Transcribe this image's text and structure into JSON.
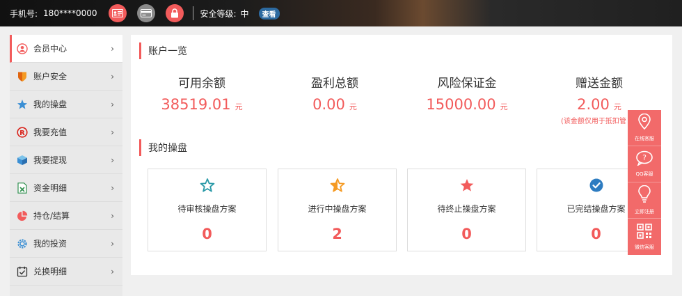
{
  "topbar": {
    "phone_label": "手机号:",
    "phone_value": "180****0000",
    "icons": [
      "id-card-icon",
      "bank-card-icon",
      "lock-icon"
    ],
    "security_label": "安全等级:",
    "security_value": "中",
    "check_button": "查看"
  },
  "sidebar": {
    "items": [
      {
        "label": "会员中心",
        "icon": "user-icon",
        "active": true
      },
      {
        "label": "账户安全",
        "icon": "shield-icon"
      },
      {
        "label": "我的操盘",
        "icon": "star-icon"
      },
      {
        "label": "我要充值",
        "icon": "recharge-icon"
      },
      {
        "label": "我要提现",
        "icon": "box-icon"
      },
      {
        "label": "资金明细",
        "icon": "spreadsheet-icon"
      },
      {
        "label": "持仓/结算",
        "icon": "pie-chart-icon"
      },
      {
        "label": "我的投资",
        "icon": "gear-icon"
      },
      {
        "label": "兑换明细",
        "icon": "calendar-check-icon"
      }
    ],
    "chevron": "›"
  },
  "account": {
    "title": "账户一览",
    "stats": [
      {
        "label": "可用余额",
        "value": "38519.01",
        "unit": "元"
      },
      {
        "label": "盈利总额",
        "value": "0.00",
        "unit": "元"
      },
      {
        "label": "风险保证金",
        "value": "15000.00",
        "unit": "元"
      },
      {
        "label": "赠送金额",
        "value": "2.00",
        "unit": "元"
      }
    ],
    "gift_note": "(该金额仅用于抵扣管"
  },
  "trading": {
    "title": "我的操盘",
    "cards": [
      {
        "label": "待审核操盘方案",
        "value": "0",
        "icon": "star-outline-icon"
      },
      {
        "label": "进行中操盘方案",
        "value": "2",
        "icon": "star-half-icon"
      },
      {
        "label": "待终止操盘方案",
        "value": "0",
        "icon": "star-filled-icon"
      },
      {
        "label": "已完结操盘方案",
        "value": "0",
        "icon": "check-circle-icon"
      }
    ]
  },
  "float_panel": {
    "items": [
      {
        "label": "在线客服",
        "icon": "location-pin-icon"
      },
      {
        "label": "QQ客服",
        "icon": "question-bubble-icon"
      },
      {
        "label": "立即注册",
        "icon": "lightbulb-icon"
      },
      {
        "label": "微信客服",
        "icon": "qr-code-icon"
      }
    ]
  },
  "colors": {
    "accent": "#f25b5b",
    "teal": "#2a9aa8",
    "orange": "#f59a23",
    "blue": "#2d7cc1"
  }
}
